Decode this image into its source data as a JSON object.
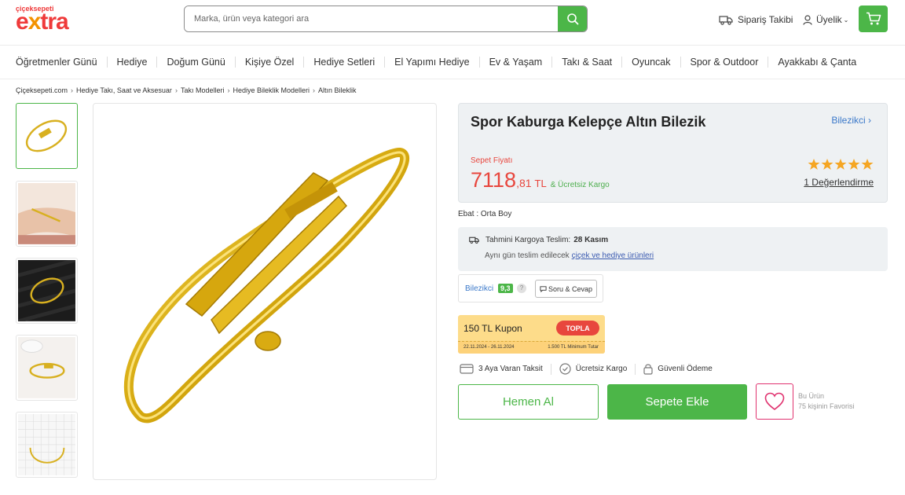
{
  "header": {
    "logo_top": "çiçeksepeti",
    "logo_main": "extra",
    "search_placeholder": "Marka, ürün veya kategori ara",
    "order_tracking": "Sipariş Takibi",
    "membership": "Üyelik"
  },
  "nav": {
    "categories": [
      "Öğretmenler Günü",
      "Hediye",
      "Doğum Günü",
      "Kişiye Özel",
      "Hediye Setleri",
      "El Yapımı Hediye",
      "Ev & Yaşam",
      "Takı & Saat",
      "Oyuncak",
      "Spor & Outdoor",
      "Ayakkabı & Çanta"
    ]
  },
  "breadcrumb": [
    "Çiçeksepeti.com",
    "Hediye Takı, Saat ve Aksesuar",
    "Takı Modelleri",
    "Hediye Bileklik Modelleri",
    "Altın Bileklik"
  ],
  "product": {
    "title": "Spor Kaburga Kelepçe Altın Bilezik",
    "seller_link": "Bilezikci ›",
    "price_label": "Sepet Fiyatı",
    "price_int": "7118",
    "price_dec": ",81",
    "currency": "TL",
    "free_shipping": "& Ücretsiz Kargo",
    "rating": 5,
    "rating_count_text": "1 Değerlendirme",
    "size": "Ebat : Orta Boy"
  },
  "delivery": {
    "label": "Tahmini Kargoya Teslim:",
    "date": "28 Kasım",
    "sameday_text": "Aynı gün teslim edilecek",
    "sameday_link": "çiçek ve hediye ürünleri"
  },
  "seller": {
    "name": "Bilezikci",
    "score": "9,3",
    "help": "?",
    "qa_button": "Soru & Cevap"
  },
  "coupon": {
    "title": "150 TL Kupon",
    "button": "TOPLA",
    "dates": "22.11.2024 - 26.11.2024",
    "min": "1.500 TL Minimum Tutar"
  },
  "features": {
    "installment": "3 Aya Varan Taksit",
    "free_shipping": "Ücretsiz Kargo",
    "secure_payment": "Güvenli Ödeme"
  },
  "actions": {
    "buy_now": "Hemen Al",
    "add_to_cart": "Sepete Ekle",
    "fav_line1": "Bu Ürün",
    "fav_line2": "75 kişinin Favorisi"
  },
  "colors": {
    "brand_green": "#4cb648",
    "price_red": "#e8463d",
    "star_orange": "#f5a623",
    "link_blue": "#3a78c9",
    "fav_pink": "#e0326f"
  },
  "icons": {
    "search": "search-icon",
    "truck": "truck-icon",
    "user": "user-icon",
    "cart": "cart-icon",
    "star": "star-icon",
    "heart": "heart-icon",
    "chat": "chat-icon",
    "card": "credit-card-icon",
    "check": "check-icon",
    "lock": "lock-icon"
  }
}
